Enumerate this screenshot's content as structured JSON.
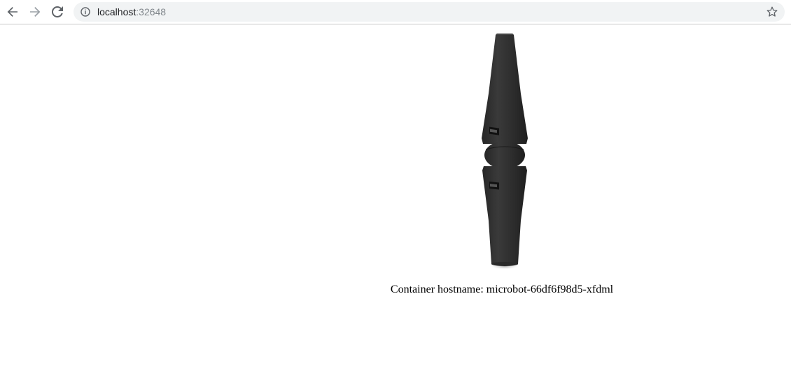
{
  "browser": {
    "url_host": "localhost",
    "url_port": ":32648",
    "icons": {
      "back": "arrow-left-icon",
      "forward": "arrow-right-icon",
      "reload": "reload-icon",
      "info": "info-icon",
      "bookmark": "star-icon"
    }
  },
  "page": {
    "image": "microbot-image",
    "hostname_text": "Container hostname: microbot-66df6f98d5-xfdml"
  }
}
